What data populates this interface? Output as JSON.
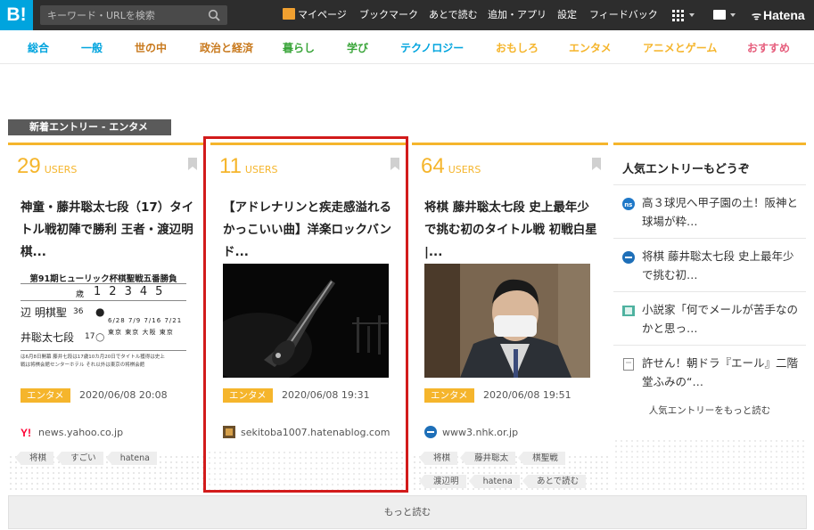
{
  "topbar": {
    "logo": "B!",
    "search_placeholder": "キーワード・URLを検索",
    "links": [
      "マイページ",
      "ブックマーク",
      "あとで読む",
      "追加・アプリ",
      "設定",
      "フィードバック"
    ],
    "brand": "Hatena"
  },
  "categories": [
    {
      "label": "総合",
      "color": "#00a4de"
    },
    {
      "label": "一般",
      "color": "#00a4de"
    },
    {
      "label": "世の中",
      "color": "#c8791d"
    },
    {
      "label": "政治と経済",
      "color": "#c8791d"
    },
    {
      "label": "暮らし",
      "color": "#3aa53a"
    },
    {
      "label": "学び",
      "color": "#3aa53a"
    },
    {
      "label": "テクノロジー",
      "color": "#00a4de"
    },
    {
      "label": "おもしろ",
      "color": "#f5b52c"
    },
    {
      "label": "エンタメ",
      "color": "#f5b52c"
    },
    {
      "label": "アニメとゲーム",
      "color": "#f5b52c"
    },
    {
      "label": "おすすめ",
      "color": "#e65d7c"
    }
  ],
  "section_label": "新着エントリー - エンタメ",
  "entries": [
    {
      "users": "29",
      "users_label": "USERS",
      "title": "神童・藤井聡太七段（17）タイトル戦初陣で勝利 王者・渡辺明棋...",
      "category": "エンタメ",
      "date": "2020/06/08 20:08",
      "source": "news.yahoo.co.jp",
      "tags": [
        "将棋",
        "すごい",
        "hatena"
      ],
      "thumb": {
        "heading": "第91期ヒューリック杯棋聖戦五番勝負",
        "age_label": "歳",
        "games": [
          "1",
          "2",
          "3",
          "4",
          "5"
        ],
        "player1": "辺 明棋聖",
        "player1_age": "36",
        "player2": "井聡太七段",
        "player2_age": "17",
        "dates": [
          "6/28",
          "7/9",
          "7/16",
          "7/21"
        ],
        "venues": [
          "東京",
          "東京",
          "大阪",
          "東京"
        ],
        "footnote1": "は6月8日開幕 藤井七段は17歳10カ月20日でタイトル獲得は史上",
        "footnote2": "戦は将棋会館センターホテル それ以外は東京の将棋会館"
      }
    },
    {
      "users": "11",
      "users_label": "USERS",
      "title": "【アドレナリンと疾走感溢れるかっこいい曲】洋楽ロックバンド...",
      "category": "エンタメ",
      "date": "2020/06/08 19:31",
      "source": "sekitoba1007.hatenablog.com",
      "tags": []
    },
    {
      "users": "64",
      "users_label": "USERS",
      "title": "将棋 藤井聡太七段 史上最年少で挑む初のタイトル戦 初戦白星 |...",
      "category": "エンタメ",
      "date": "2020/06/08 19:51",
      "source": "www3.nhk.or.jp",
      "tags": [
        "将棋",
        "藤井聡太",
        "棋聖戦",
        "渡辺明",
        "hatena",
        "あとで読む"
      ]
    }
  ],
  "sidebar": {
    "title": "人気エントリーもどうぞ",
    "items": [
      {
        "text": "高３球児へ甲子園の土！阪神と球場が粋…",
        "icon": "ns-icon"
      },
      {
        "text": "将棋 藤井聡太七段 史上最年少で挑む初…",
        "icon": "nhk-icon"
      },
      {
        "text": "小説家「何でメールが苦手なのかと思っ…",
        "icon": "book-icon"
      },
      {
        "text": "許せん！朝ドラ『エール』二階堂ふみの“…",
        "icon": "page-icon"
      }
    ],
    "more": "人気エントリーをもっと読む"
  },
  "more_button": "もっと読む",
  "colors": {
    "accent": "#f5b52c",
    "brand": "#00a4de",
    "highlight": "#d21b1b"
  }
}
